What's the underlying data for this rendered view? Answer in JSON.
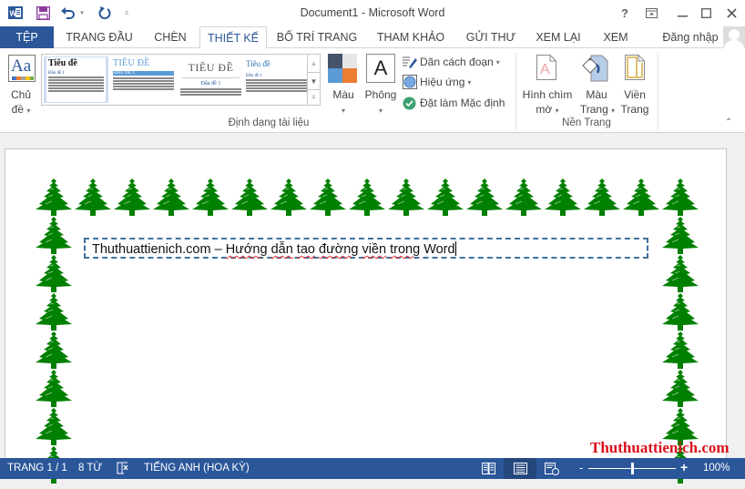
{
  "window": {
    "title": "Document1 - Microsoft Word",
    "help_label": "?",
    "controls": [
      "ribbon-display-options",
      "minimize",
      "maximize",
      "close"
    ]
  },
  "quick_access": {
    "icons": [
      "word-logo-icon",
      "save-icon",
      "undo-icon",
      "redo-icon",
      "customize-icon"
    ]
  },
  "tabs": [
    {
      "label": "TỆP",
      "active": false
    },
    {
      "label": "TRANG ĐẦU",
      "active": false
    },
    {
      "label": "CHÈN",
      "active": false
    },
    {
      "label": "THIẾT KẾ",
      "active": true
    },
    {
      "label": "BỐ TRÍ TRANG",
      "active": false
    },
    {
      "label": "THAM KHẢO",
      "active": false
    },
    {
      "label": "GỬI THƯ",
      "active": false
    },
    {
      "label": "XEM LẠI",
      "active": false
    },
    {
      "label": "XEM",
      "active": false
    }
  ],
  "account": {
    "signin_label": "Đăng nhập"
  },
  "ribbon": {
    "themes": {
      "label_line1": "Chủ",
      "label_line2": "đề"
    },
    "gallery": {
      "items": [
        {
          "title": "Tiêu đề",
          "heading": "Đầu đề 1"
        },
        {
          "title": "TIÊU ĐỀ",
          "heading": "ĐẦU ĐỀ 1"
        },
        {
          "title": "TIÊU ĐỀ",
          "heading": "Đầu đề 1"
        },
        {
          "title": "Tiêu đề",
          "heading": "Đầu đề 1"
        }
      ]
    },
    "colors_label": "Màu",
    "fonts_label": "Phông",
    "paragraph_spacing_label": "Dãn cách đoạn",
    "effects_label": "Hiệu ứng",
    "set_default_label": "Đặt làm Mặc định",
    "document_formatting_group": "Định dạng tài liệu",
    "watermark": {
      "line1": "Hình chìm",
      "line2": "mờ"
    },
    "page_color": {
      "line1": "Màu",
      "line2": "Trang"
    },
    "page_borders": {
      "line1": "Viền",
      "line2": "Trang"
    },
    "page_background_group": "Nền Trang",
    "theme_colors": {
      "dark": "#44546a",
      "light": "#e7e6e6",
      "blue": "#5b9bd5",
      "orange": "#ed7d31"
    }
  },
  "document": {
    "text_plain": "Thuthuattienich.com – ",
    "text_underlined": [
      "Hướng",
      "dẫn",
      "tao",
      "đường",
      "viền",
      "trong"
    ],
    "text_end": "Word",
    "border_art": "tree",
    "border_color": "#008000",
    "textbox_border_color": "#41719c"
  },
  "watermark_text": "Thuthuattienich.com",
  "status": {
    "page": "TRANG 1 / 1",
    "words": "8 TỪ",
    "language": "TIẾNG ANH (HOA KỲ)",
    "zoom_level": "100%",
    "zoom_fraction": 0.5,
    "views": [
      "read-mode",
      "print-layout",
      "web-layout"
    ],
    "active_view": "print-layout"
  }
}
